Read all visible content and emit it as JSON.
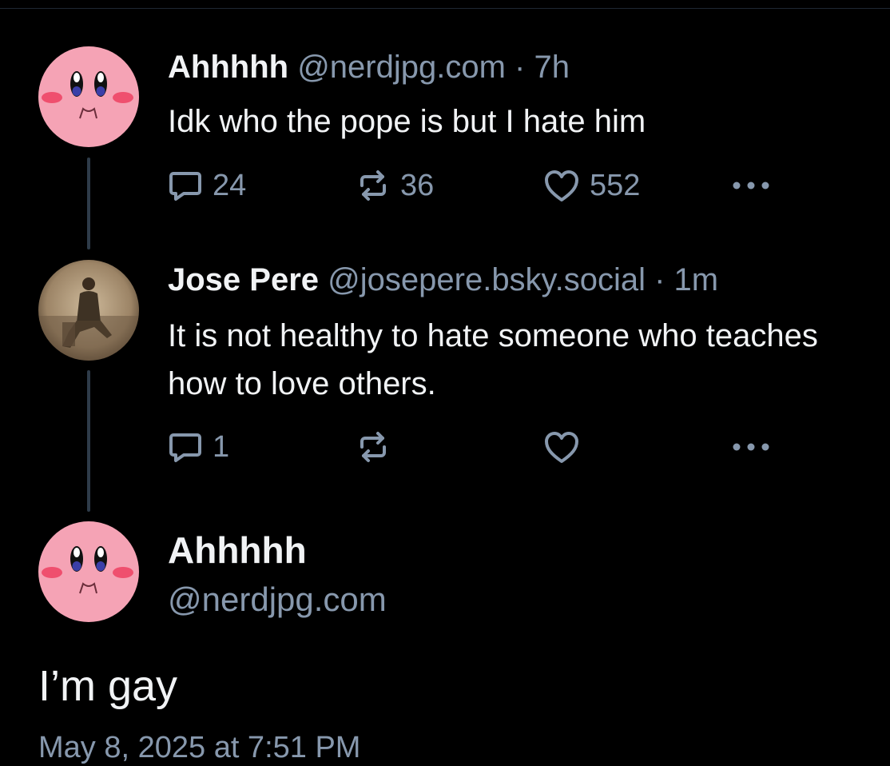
{
  "posts": [
    {
      "display_name": "Ahhhhh",
      "handle": "@nerdjpg.com",
      "separator": "·",
      "time": "7h",
      "text": "Idk who the pope is but I hate him",
      "replies": "24",
      "reposts": "36",
      "likes": "552",
      "avatar_icon": "kirby-avatar-icon"
    },
    {
      "display_name": "Jose Pere",
      "handle": "@josepere.bsky.social",
      "separator": "·",
      "time": "1m",
      "text": "It is not healthy to hate someone who teaches how to love others.",
      "replies": "1",
      "reposts": "",
      "likes": "",
      "avatar_icon": "vintage-photo-avatar-icon"
    }
  ],
  "main_post": {
    "display_name": "Ahhhhh",
    "handle": "@nerdjpg.com",
    "text": "I’m gay",
    "timestamp": "May 8, 2025 at 7:51 PM",
    "avatar_icon": "kirby-avatar-icon"
  },
  "colors": {
    "background": "#000000",
    "text": "#f1f3f5",
    "muted": "#8798ad",
    "thread_line": "#2e3b49",
    "avatar_pink": "#f5a3b5"
  },
  "icons": {
    "reply": "reply-bubble-icon",
    "repost": "repost-arrows-icon",
    "like": "heart-icon",
    "more": "ellipsis-icon"
  }
}
